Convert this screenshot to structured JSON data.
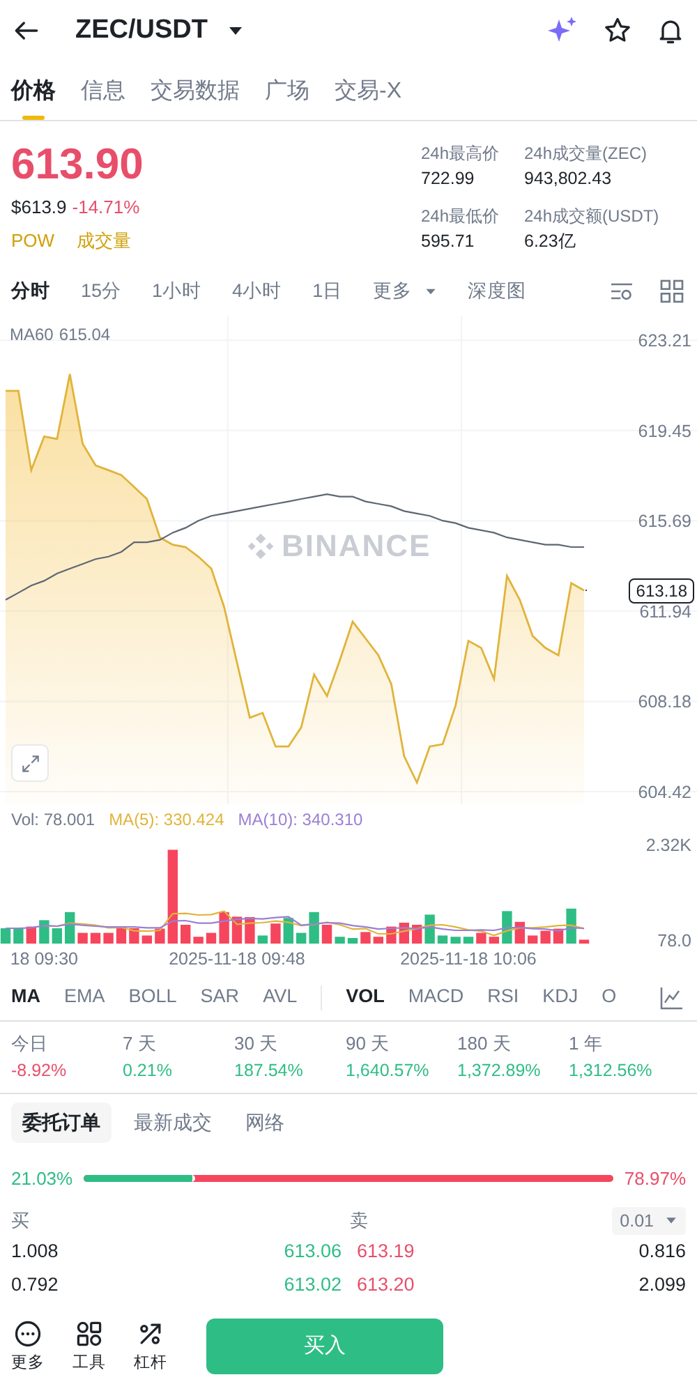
{
  "header": {
    "title": "ZEC/USDT"
  },
  "tabs": [
    {
      "label": "价格",
      "selected": true
    },
    {
      "label": "信息",
      "selected": false
    },
    {
      "label": "交易数据",
      "selected": false
    },
    {
      "label": "广场",
      "selected": false
    },
    {
      "label": "交易-X",
      "selected": false
    }
  ],
  "price": {
    "last": "613.90",
    "usd": "$613.9",
    "change": "-14.71%",
    "tags": [
      "POW",
      "成交量"
    ]
  },
  "stats": [
    {
      "label": "24h最高价",
      "value": "722.99"
    },
    {
      "label": "24h成交量(ZEC)",
      "value": "943,802.43"
    },
    {
      "label": "24h最低价",
      "value": "595.71"
    },
    {
      "label": "24h成交额(USDT)",
      "value": "6.23亿"
    }
  ],
  "intervals": [
    {
      "label": "分时",
      "selected": true,
      "dropdown": false
    },
    {
      "label": "15分",
      "selected": false,
      "dropdown": false
    },
    {
      "label": "1小时",
      "selected": false,
      "dropdown": false
    },
    {
      "label": "4小时",
      "selected": false,
      "dropdown": false
    },
    {
      "label": "1日",
      "selected": false,
      "dropdown": false
    },
    {
      "label": "更多",
      "selected": false,
      "dropdown": true
    },
    {
      "label": "深度图",
      "selected": false,
      "dropdown": false
    }
  ],
  "price_chart": {
    "ma_reading": "615.04",
    "watermark": "BINANCE",
    "current_price": "613.18",
    "chart_data": {
      "type": "area",
      "grid": true,
      "ylim": [
        603.9,
        624.2
      ],
      "yticks": [
        {
          "value": 623.21,
          "label": "623.21"
        },
        {
          "value": 619.45,
          "label": "619.45"
        },
        {
          "value": 615.69,
          "label": "615.69"
        },
        {
          "value": 611.94,
          "label": "611.94"
        },
        {
          "value": 608.18,
          "label": "608.18"
        },
        {
          "value": 604.42,
          "label": "604.42"
        }
      ],
      "series": [
        {
          "color": "#e0b43a",
          "values": [
            621.1,
            621.1,
            617.8,
            619.2,
            619.1,
            621.8,
            618.9,
            618.0,
            617.8,
            617.6,
            617.1,
            616.6,
            615.0,
            614.7,
            614.6,
            614.2,
            613.7,
            612.1,
            609.8,
            607.5,
            607.7,
            606.3,
            606.3,
            607.1,
            609.3,
            608.4,
            609.9,
            611.5,
            610.8,
            610.1,
            608.9,
            605.9,
            604.8,
            606.3,
            606.4,
            608.0,
            610.7,
            610.4,
            609.1,
            613.4,
            612.4,
            610.9,
            610.4,
            610.1,
            613.1,
            612.8
          ]
        },
        {
          "name": "MA60",
          "type": "line",
          "color": "#5e6673",
          "values": [
            612.4,
            612.7,
            613.0,
            613.2,
            613.5,
            613.7,
            613.9,
            614.1,
            614.2,
            614.4,
            614.8,
            614.8,
            614.9,
            615.2,
            615.4,
            615.7,
            615.9,
            616.0,
            616.1,
            616.2,
            616.3,
            616.4,
            616.5,
            616.6,
            616.7,
            616.8,
            616.7,
            616.7,
            616.5,
            616.4,
            616.3,
            616.1,
            616.0,
            615.9,
            615.7,
            615.6,
            615.4,
            615.3,
            615.2,
            615.0,
            614.9,
            614.8,
            614.7,
            614.7,
            614.6,
            614.6
          ]
        }
      ]
    }
  },
  "volume": {
    "vol": "Vol: 78.001",
    "ma5_reading": ": 330.424",
    "ma10_reading": ": 340.310",
    "chart_data": {
      "type": "bar",
      "categories": [
        null,
        null,
        null,
        "18 09:30",
        null,
        null,
        null,
        null,
        null,
        null,
        null,
        null,
        null,
        null,
        null,
        null,
        null,
        null,
        "2025-11-18 09:48",
        null,
        null,
        null,
        null,
        null,
        null,
        null,
        null,
        null,
        null,
        null,
        null,
        null,
        null,
        null,
        null,
        null,
        "2025-11-18 10:06",
        null,
        null,
        null,
        null,
        null,
        null,
        null,
        null,
        null
      ],
      "ylim": [
        0,
        2320
      ],
      "yticks": [
        {
          "value": 2320,
          "label": "2.32K"
        },
        {
          "value": 78,
          "label": "78.0"
        }
      ],
      "series": [
        {
          "color": "#2ebd85",
          "values": [
            360,
            360,
            null,
            550,
            360,
            740,
            null,
            null,
            null,
            null,
            null,
            null,
            null,
            null,
            null,
            null,
            null,
            null,
            null,
            null,
            190,
            null,
            600,
            250,
            740,
            null,
            160,
            130,
            null,
            null,
            null,
            null,
            null,
            680,
            190,
            160,
            160,
            null,
            null,
            760,
            null,
            null,
            null,
            null,
            820,
            null
          ]
        },
        {
          "color": "#f6465d",
          "values": [
            null,
            null,
            400,
            null,
            null,
            null,
            250,
            250,
            250,
            380,
            360,
            190,
            350,
            2200,
            440,
            160,
            250,
            740,
            630,
            620,
            null,
            470,
            null,
            null,
            null,
            440,
            null,
            null,
            270,
            160,
            400,
            490,
            440,
            null,
            null,
            null,
            null,
            250,
            160,
            null,
            510,
            190,
            300,
            350,
            null,
            90
          ]
        },
        {
          "name": "MA(5)",
          "type": "line",
          "color": "#e0b43a",
          "values": [
            null,
            null,
            null,
            420,
            410,
            480,
            460,
            430,
            370,
            380,
            300,
            290,
            310,
            700,
            710,
            670,
            680,
            760,
            450,
            480,
            490,
            530,
            500,
            420,
            450,
            500,
            440,
            340,
            350,
            230,
            230,
            290,
            350,
            430,
            440,
            390,
            320,
            290,
            190,
            300,
            370,
            370,
            390,
            420,
            430,
            350
          ]
        },
        {
          "name": "MA(10)",
          "type": "line",
          "color": "#9b7fd4",
          "values": [
            360,
            360,
            370,
            420,
            410,
            460,
            430,
            410,
            390,
            390,
            390,
            370,
            370,
            530,
            540,
            480,
            480,
            530,
            570,
            590,
            580,
            610,
            630,
            430,
            460,
            490,
            480,
            420,
            390,
            340,
            360,
            370,
            350,
            390,
            340,
            310,
            310,
            320,
            310,
            370,
            380,
            350,
            340,
            300,
            370,
            360
          ]
        }
      ]
    }
  },
  "main_indicators": [
    {
      "label": "MA",
      "selected": true
    },
    {
      "label": "EMA",
      "selected": false
    },
    {
      "label": "BOLL",
      "selected": false
    },
    {
      "label": "SAR",
      "selected": false
    },
    {
      "label": "AVL",
      "selected": false
    }
  ],
  "sub_indicators": [
    {
      "label": "VOL",
      "selected": true
    },
    {
      "label": "MACD",
      "selected": false
    },
    {
      "label": "RSI",
      "selected": false
    },
    {
      "label": "KDJ",
      "selected": false
    },
    {
      "label": "O",
      "selected": false
    }
  ],
  "performance": [
    {
      "period": "今日",
      "change": "-8.92%",
      "color": "#e84e6a"
    },
    {
      "period": "7 天",
      "change": "0.21%",
      "color": "#2ebd85"
    },
    {
      "period": "30 天",
      "change": "187.54%",
      "color": "#2ebd85"
    },
    {
      "period": "90 天",
      "change": "1,640.57%",
      "color": "#2ebd85"
    },
    {
      "period": "180 天",
      "change": "1,372.89%",
      "color": "#2ebd85"
    },
    {
      "period": "1 年",
      "change": "1,312.56%",
      "color": "#2ebd85"
    }
  ],
  "order_tabs": [
    {
      "label": "委托订单",
      "selected": true
    },
    {
      "label": "最新成交",
      "selected": false
    },
    {
      "label": "网络",
      "selected": false
    }
  ],
  "depth_ratio": {
    "bid": "21.03%",
    "ask": "78.97%",
    "level": 0.2103
  },
  "order_book": {
    "bid_header": "买",
    "ask_header": "卖",
    "precision": "0.01",
    "rows": [
      {
        "bid_size": "1.008",
        "bid_price": "613.06",
        "ask_price": "613.19",
        "ask_size": "0.816"
      },
      {
        "bid_size": "0.792",
        "bid_price": "613.02",
        "ask_price": "613.20",
        "ask_size": "2.099"
      }
    ]
  },
  "bottom_bar": {
    "actions": [
      {
        "label": "更多"
      },
      {
        "label": "工具"
      },
      {
        "label": "杠杆"
      }
    ],
    "buy": "买入"
  }
}
